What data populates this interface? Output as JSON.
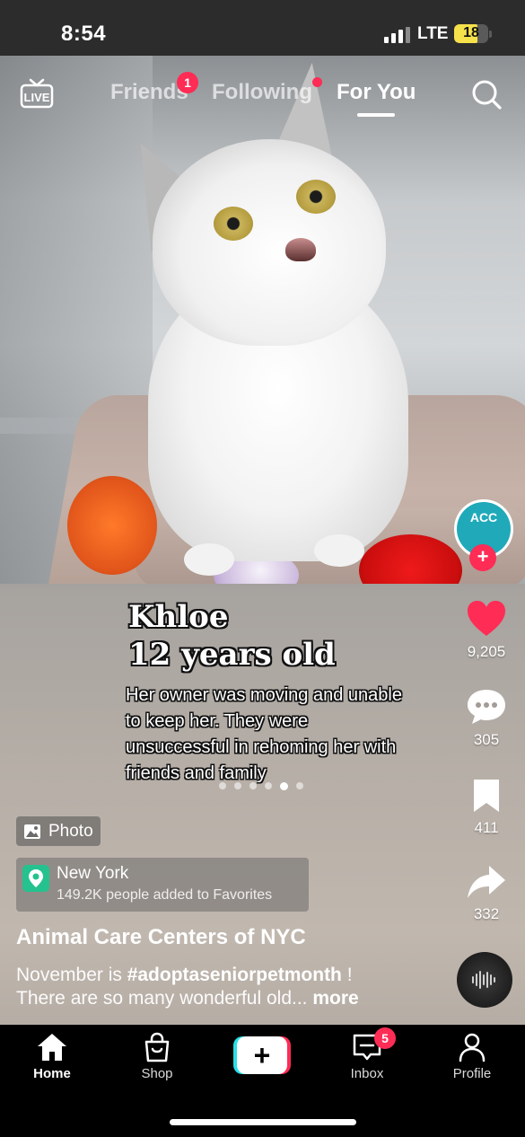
{
  "status_bar": {
    "time": "8:54",
    "network": "LTE",
    "battery_level": "18",
    "battery_color": "#f5e14a"
  },
  "top_nav": {
    "live_icon": "live-tv-icon",
    "tabs": [
      {
        "label": "Friends",
        "badge": "1"
      },
      {
        "label": "Following",
        "has_dot": true
      },
      {
        "label": "For You",
        "active": true
      }
    ],
    "search_icon": "search-icon"
  },
  "post": {
    "caption": {
      "title_line1": "Khloe",
      "title_line2": "12 years old",
      "body": "Her owner was moving and unable to keep her. They were unsuccessful in rehoming her with friends and family"
    },
    "carousel": {
      "total": 6,
      "active_index": 4
    },
    "photo_tag": "Photo",
    "location": {
      "name": "New York",
      "subtitle": "149.2K people added to Favorites"
    },
    "account_name": "Animal Care Centers of NYC",
    "description_prefix": "November is ",
    "description_hashtag": "#adoptaseniorpetmonth",
    "description_suffix": " !",
    "description_line2": "There are so many wonderful old...",
    "more_label": " more"
  },
  "right_rail": {
    "avatar_text": "ACC",
    "follow_plus": "+",
    "like_count": "9,205",
    "comment_count": "305",
    "bookmark_count": "411",
    "share_count": "332",
    "accent_color": "#ff2c55"
  },
  "bottom_nav": {
    "items": [
      {
        "label": "Home",
        "icon": "home-icon",
        "active": true
      },
      {
        "label": "Shop",
        "icon": "shopping-bag-icon"
      },
      {
        "label": "",
        "icon": "create-plus-icon"
      },
      {
        "label": "Inbox",
        "icon": "inbox-icon",
        "badge": "5"
      },
      {
        "label": "Profile",
        "icon": "profile-icon"
      }
    ],
    "create_plus": "+"
  }
}
